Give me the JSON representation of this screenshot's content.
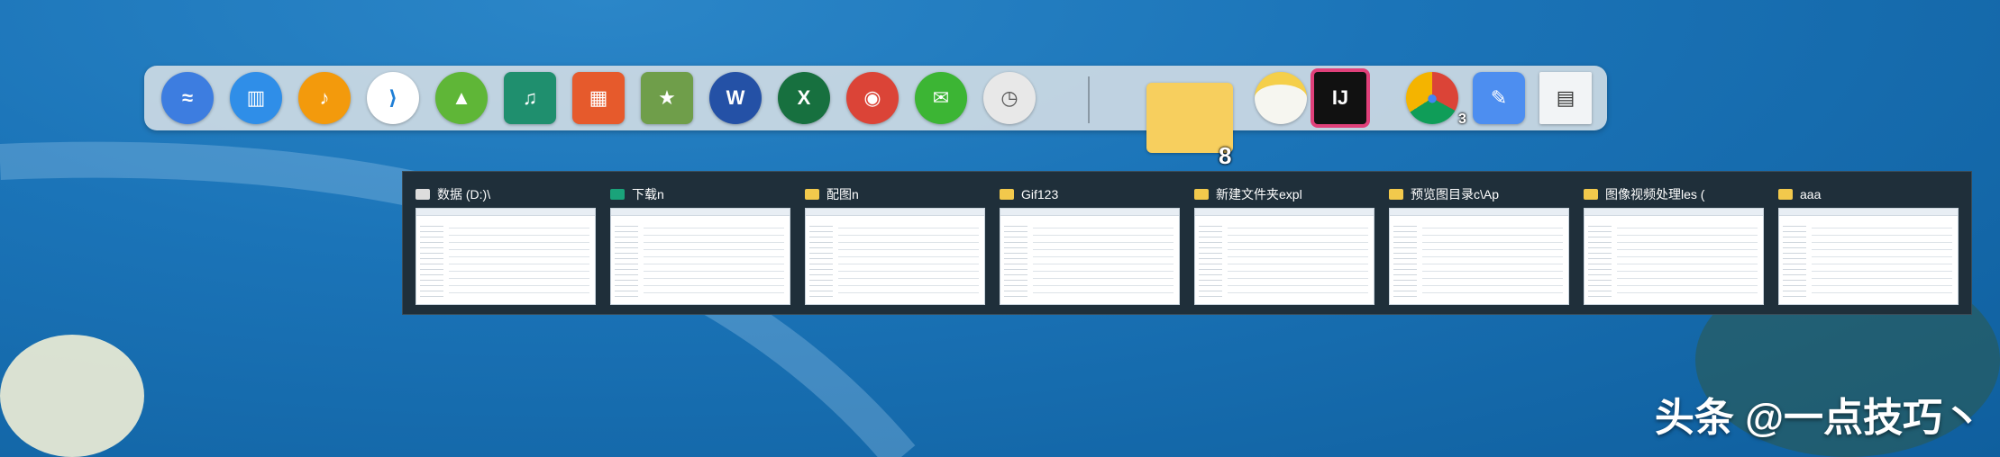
{
  "dock": {
    "left_apps": [
      {
        "name": "wave-app-icon",
        "color": "#3d7de0"
      },
      {
        "name": "dashboard-app-icon",
        "color": "#2f8ee8"
      },
      {
        "name": "music-app-icon",
        "color": "#f39a0c"
      },
      {
        "name": "vscode-icon",
        "color": "#ffffff"
      },
      {
        "name": "screen-cast-icon",
        "color": "#5fb637"
      },
      {
        "name": "music-folder-icon",
        "color": "#1f8f6e"
      },
      {
        "name": "apps-folder-icon",
        "color": "#e65a2c"
      },
      {
        "name": "favorites-folder-icon",
        "color": "#6f9e4a"
      },
      {
        "name": "word-icon",
        "color": "#2451a6"
      },
      {
        "name": "excel-icon",
        "color": "#17703f"
      },
      {
        "name": "chrome-icon",
        "color": "#db4437"
      },
      {
        "name": "wechat-icon",
        "color": "#3cb534"
      },
      {
        "name": "clock-icon",
        "color": "#e8e8e8"
      }
    ],
    "right_apps": [
      {
        "name": "file-explorer-icon",
        "badge": "8"
      },
      {
        "name": "notes-icon",
        "badge": ""
      },
      {
        "name": "intellij-icon",
        "label": "IJ",
        "badge": ""
      },
      {
        "name": "chrome-icon",
        "badge": "3"
      },
      {
        "name": "pen-app-icon",
        "badge": ""
      },
      {
        "name": "screenshot-window-icon",
        "badge": ""
      }
    ]
  },
  "windows": [
    {
      "title": "数据 (D:)\\",
      "icon": "drive-icon"
    },
    {
      "title": "下载n",
      "icon": "download-folder-icon"
    },
    {
      "title": "配图n",
      "icon": "folder-icon"
    },
    {
      "title": "Gif123",
      "icon": "folder-icon"
    },
    {
      "title": "新建文件夹expl",
      "icon": "folder-icon"
    },
    {
      "title": "预览图目录c\\Ap",
      "icon": "folder-icon"
    },
    {
      "title": "图像视频处理les (",
      "icon": "folder-icon"
    },
    {
      "title": "aaa",
      "icon": "folder-icon"
    }
  ],
  "watermark": "头条 @一点技巧丶"
}
